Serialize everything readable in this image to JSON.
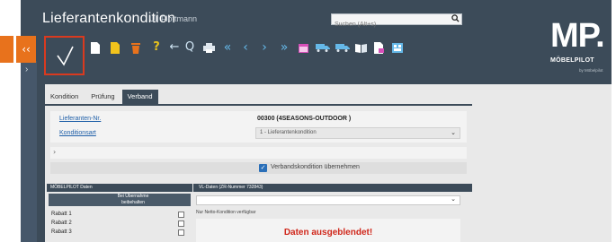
{
  "header": {
    "app_title": "Lieferantenkondition",
    "user_name": "Uli Flottmann",
    "search_placeholder": "Suchen (Alt+s)"
  },
  "side_strip": {
    "left_tab_label": "‹‹",
    "expand_glyph": "›"
  },
  "toolbar": {
    "confirm_glyph": "check-icon",
    "help_glyph": "?",
    "back_glyph": "←",
    "search_glyph": "Q",
    "first_glyph": "«",
    "prev_glyph": "‹",
    "next_glyph": "›",
    "last_glyph": "»",
    "icons": [
      "new-document-icon",
      "copy-document-icon",
      "delete-icon",
      "help-icon",
      "back-icon",
      "find-icon",
      "print-icon",
      "first-record-icon",
      "previous-record-icon",
      "next-record-icon",
      "last-record-icon",
      "calendar-icon",
      "truck-icon",
      "truck-return-icon",
      "book-icon",
      "document-export-icon",
      "grid-icon"
    ]
  },
  "logo": {
    "main": "MP.",
    "name": "MÖBELPILOT",
    "tagline": "by Möbelpilot"
  },
  "tabs": [
    {
      "label": "Kondition"
    },
    {
      "label": "Prüfung"
    },
    {
      "label": "Verband"
    }
  ],
  "form": {
    "supplier_label": "Lieferanten-Nr.",
    "supplier_value": "00300 (4SEASONS-OUTDOOR )",
    "condition_label": "Konditionsart",
    "condition_value": "1 - Lieferantenkondition"
  },
  "collapse_glyph": "›",
  "verband": {
    "checkbox_label": "Verbandskondition übernehmen",
    "checked": true
  },
  "left_table": {
    "header": "MÖBELPILOT Daten",
    "column_header_line1": "Bei Übernahme",
    "column_header_line2": "beibehalten",
    "rows": [
      {
        "label": "Rabatt 1"
      },
      {
        "label": "Rabatt 2"
      },
      {
        "label": "Rabatt 3"
      }
    ]
  },
  "right_table": {
    "header": "VL-Daten (ZR-Nummer 732843)",
    "netto_note": "Nur Netto-Kondition verfügbar",
    "hidden_message": "Daten ausgeblendet!"
  },
  "colors": {
    "frame": "#3c4b59",
    "accent_orange": "#e8721c",
    "highlight_red": "#d93a1f",
    "nav_blue": "#65b8e8",
    "link_blue": "#1f5fa8",
    "alert_red": "#d0271b"
  }
}
